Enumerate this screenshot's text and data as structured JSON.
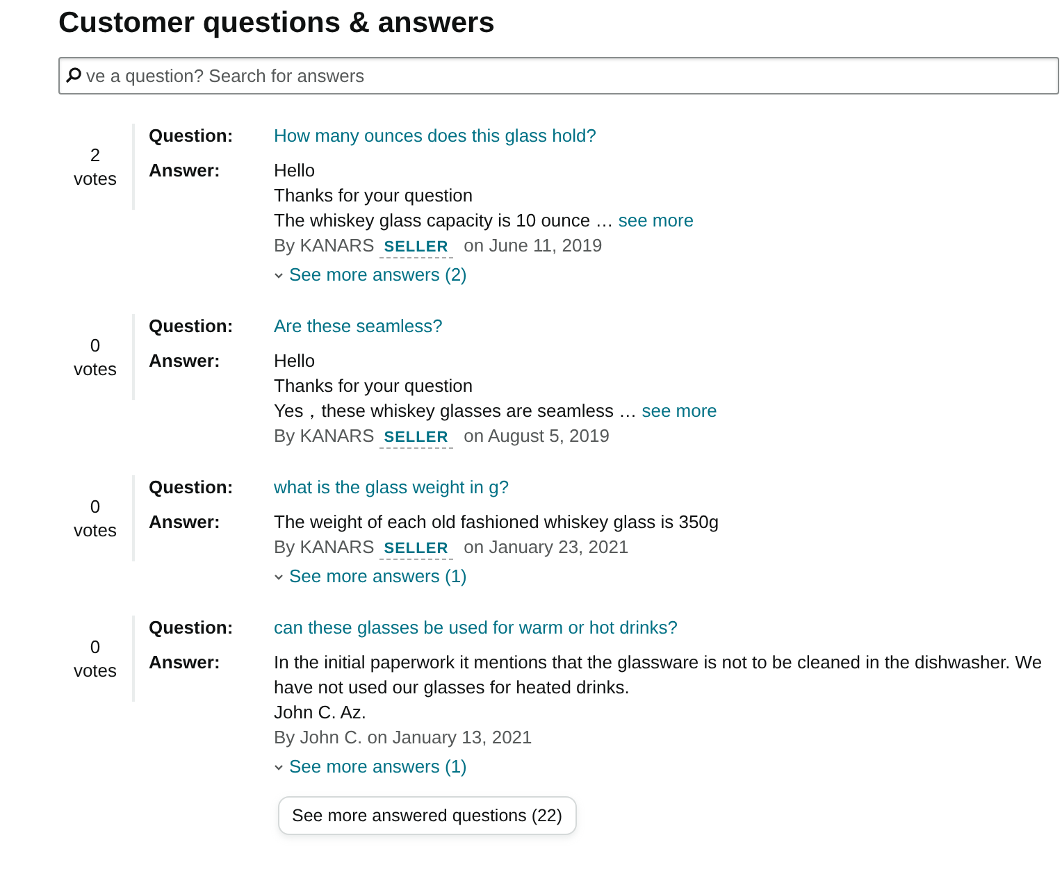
{
  "title": "Customer questions & answers",
  "search": {
    "placeholder": "ve a question? Search for answers"
  },
  "questions": [
    {
      "votes": "2",
      "votes_label": "votes",
      "question_label": "Question:",
      "question": "How many ounces does this glass hold?",
      "answer_label": "Answer:",
      "answer_lines": [
        "Hello",
        "Thanks for your question",
        "The whiskey glass capacity is 10 ounce …"
      ],
      "see_more": "see more",
      "author": "By KANARS",
      "badge": "SELLER",
      "date": "on June 11, 2019",
      "more_answers": "See more answers (2)"
    },
    {
      "votes": "0",
      "votes_label": "votes",
      "question_label": "Question:",
      "question": "Are these seamless?",
      "answer_label": "Answer:",
      "answer_lines": [
        "Hello",
        "Thanks for your question",
        "Yes，these whiskey glasses are seamless …"
      ],
      "see_more": "see more",
      "author": "By KANARS",
      "badge": "SELLER",
      "date": "on August 5, 2019"
    },
    {
      "votes": "0",
      "votes_label": "votes",
      "question_label": "Question:",
      "question": "what is the glass weight in g?",
      "answer_label": "Answer:",
      "answer_lines": [
        "The weight of each old fashioned whiskey glass is 350g"
      ],
      "author": "By KANARS",
      "badge": "SELLER",
      "date": "on January 23, 2021",
      "more_answers": "See more answers (1)"
    },
    {
      "votes": "0",
      "votes_label": "votes",
      "question_label": "Question:",
      "question": "can these glasses be used for warm or hot drinks?",
      "answer_label": "Answer:",
      "answer_lines": [
        "In the initial paperwork it mentions that the glassware is not to be cleaned in the dishwasher. We have not used our glasses for heated drinks.",
        "John C. Az."
      ],
      "author": "By John C.",
      "date": "on January 13, 2021",
      "more_answers": "See more answers (1)"
    }
  ],
  "more_button": "See more answered questions (22)"
}
